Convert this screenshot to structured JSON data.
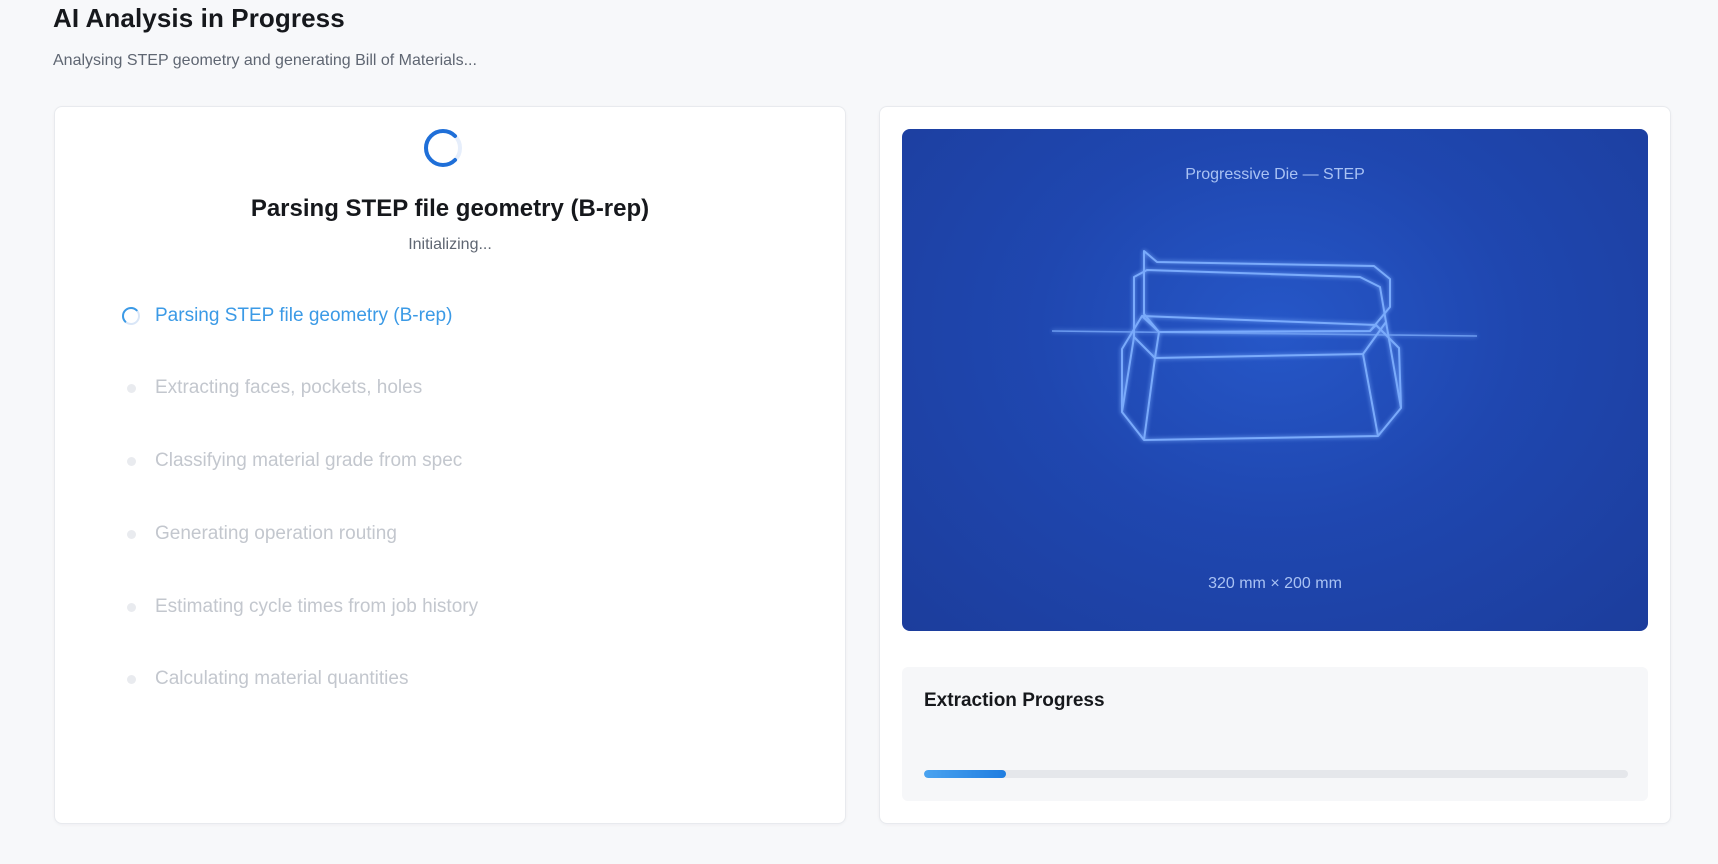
{
  "page": {
    "title": "AI Analysis in Progress",
    "subtitle": "Analysing STEP geometry and generating Bill of Materials..."
  },
  "current_step": {
    "title": "Parsing STEP file geometry (B-rep)",
    "status": "Initializing..."
  },
  "steps": [
    {
      "label": "Parsing STEP file geometry (B-rep)",
      "state": "active"
    },
    {
      "label": "Extracting faces, pockets, holes",
      "state": "pending"
    },
    {
      "label": "Classifying material grade from spec",
      "state": "pending"
    },
    {
      "label": "Generating operation routing",
      "state": "pending"
    },
    {
      "label": "Estimating cycle times from job history",
      "state": "pending"
    },
    {
      "label": "Calculating material quantities",
      "state": "pending"
    }
  ],
  "preview": {
    "title": "Progressive Die — STEP",
    "dimensions": "320 mm × 200 mm"
  },
  "progress": {
    "label": "Extraction Progress",
    "fraction": 0.117
  },
  "colors": {
    "accent": "#1f7de0",
    "active_step": "#3b9ae6",
    "pending_step": "#c3c7ce",
    "preview_bg": "#1f47b0"
  },
  "icons": {
    "current_spinner": "loading-spinner-icon",
    "active_step": "loading-spinner-icon",
    "pending_step": "dot-icon"
  }
}
